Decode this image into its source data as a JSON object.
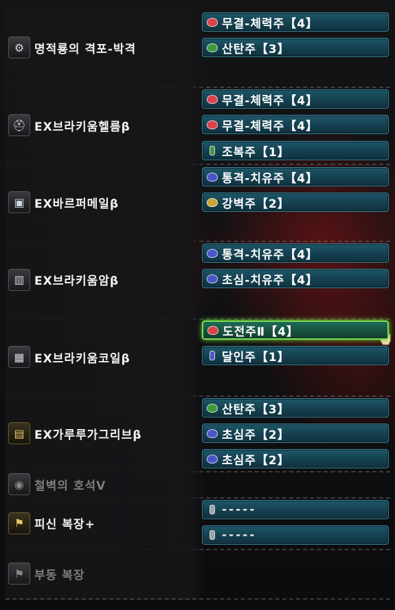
{
  "colors": {
    "red_gem": "#d8424a",
    "green_gem": "#3e9a3c",
    "blue_gem": "#4a56c8",
    "yellow_gem": "#c8a534",
    "slot_bg": "#1a4d5e",
    "selected_border": "#7ee04c"
  },
  "equipment": [
    {
      "name": "명적룡의 격포-박격",
      "icon": "weapon-icon",
      "slots": [
        {
          "label": "무결-체력주【4】",
          "gem": "red"
        },
        {
          "label": "산탄주【3】",
          "gem": "green"
        }
      ]
    },
    {
      "name": "EX브라키움헬름β",
      "icon": "helmet-icon",
      "slots": [
        {
          "label": "무결-체력주【4】",
          "gem": "red"
        },
        {
          "label": "무결-체력주【4】",
          "gem": "red"
        },
        {
          "label": "조복주【1】",
          "gem": "green-small"
        }
      ]
    },
    {
      "name": "EX바르퍼메일β",
      "icon": "chest-armor-icon",
      "slots": [
        {
          "label": "통격-치유주【4】",
          "gem": "blue"
        },
        {
          "label": "강벽주【2】",
          "gem": "yellow"
        }
      ]
    },
    {
      "name": "EX브라키움암β",
      "icon": "arm-armor-icon",
      "slots": [
        {
          "label": "통격-치유주【4】",
          "gem": "blue"
        },
        {
          "label": "초심-치유주【4】",
          "gem": "blue"
        }
      ]
    },
    {
      "name": "EX브라키움코일β",
      "icon": "waist-armor-icon",
      "slots": [
        {
          "label": "도전주Ⅱ【4】",
          "gem": "red",
          "selected": true
        },
        {
          "label": "달인주【1】",
          "gem": "blue-small"
        }
      ]
    },
    {
      "name": "EX가루루가그리브β",
      "icon": "leg-armor-icon",
      "slots": [
        {
          "label": "산탄주【3】",
          "gem": "green"
        },
        {
          "label": "초심주【2】",
          "gem": "blue"
        },
        {
          "label": "초심주【2】",
          "gem": "blue"
        }
      ]
    },
    {
      "name": "철벽의 호석Ⅴ",
      "icon": "charm-icon",
      "dim": true,
      "slots": []
    },
    {
      "name": "피신 복장+",
      "icon": "mantle-icon",
      "slots": [
        {
          "label": "-----",
          "gem": "empty"
        },
        {
          "label": "-----",
          "gem": "empty"
        }
      ]
    },
    {
      "name": "부동 복장",
      "icon": "mantle-icon",
      "dim": true,
      "slots": []
    }
  ]
}
